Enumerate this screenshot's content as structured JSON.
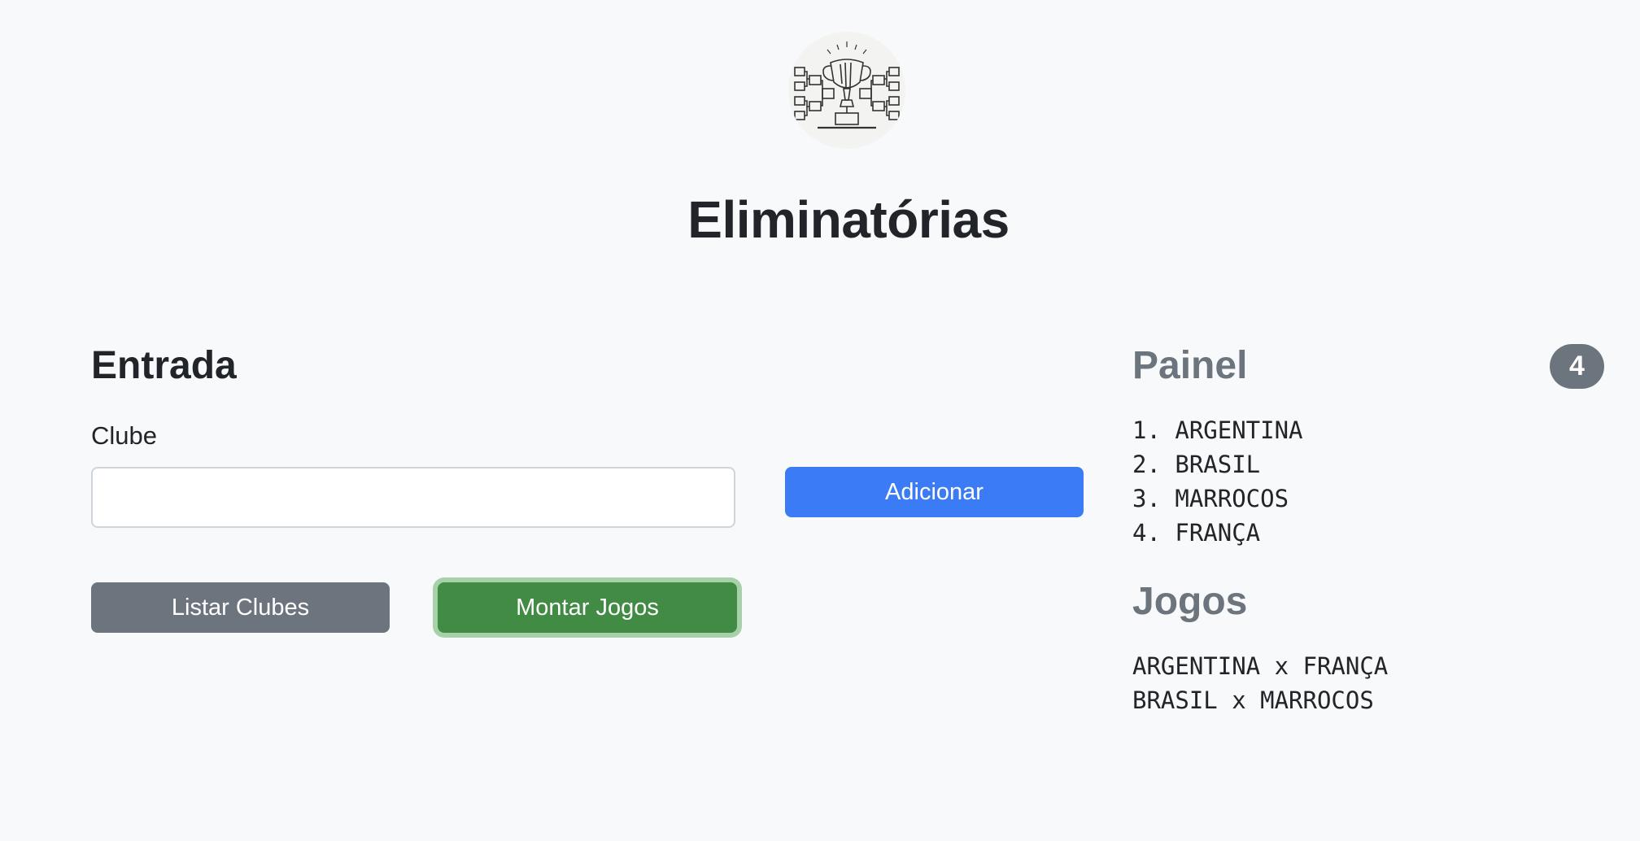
{
  "header": {
    "title": "Eliminatórias",
    "logo_icon": "trophy-bracket-icon"
  },
  "entrada": {
    "title": "Entrada",
    "club_label": "Clube",
    "club_value": "",
    "club_placeholder": "",
    "add_button": "Adicionar",
    "list_button": "Listar Clubes",
    "mount_button": "Montar Jogos"
  },
  "painel": {
    "title": "Painel",
    "count": "4",
    "clubs": [
      "1. ARGENTINA",
      "2. BRASIL",
      "3. MARROCOS",
      "4. FRANÇA"
    ]
  },
  "jogos": {
    "title": "Jogos",
    "matches": [
      "ARGENTINA x FRANÇA",
      "BRASIL x MARROCOS"
    ]
  },
  "colors": {
    "background": "#f8f9fa",
    "primary": "#3b7cf6",
    "secondary": "#6c757d",
    "success": "#428b45",
    "success_focus_ring": "#a7d2a9"
  }
}
